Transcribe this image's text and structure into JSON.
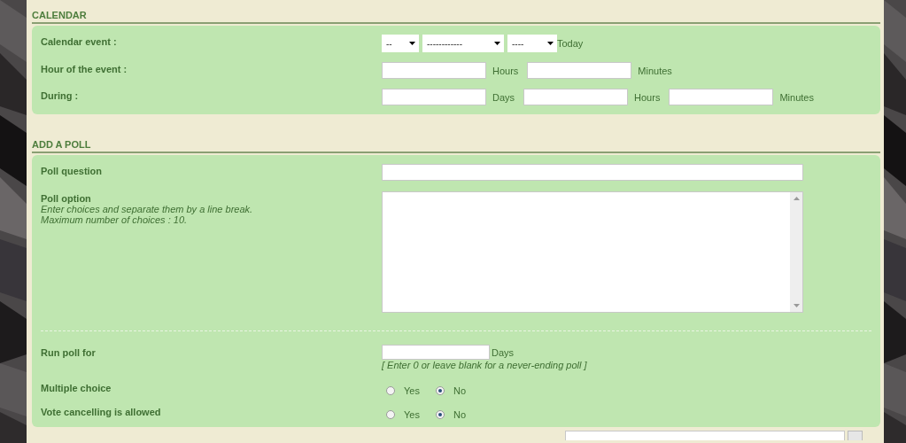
{
  "calendar": {
    "title": "CALENDAR",
    "rows": [
      {
        "kind": "date",
        "label": "Calendar event :",
        "selects": [
          "--",
          "------------",
          "----"
        ],
        "link": "Today"
      },
      {
        "kind": "fields",
        "label": "Hour of the event :",
        "units": [
          "Hours",
          "Minutes"
        ]
      },
      {
        "kind": "fields",
        "label": "During :",
        "units": [
          "Days",
          "Hours",
          "Minutes"
        ]
      }
    ]
  },
  "poll": {
    "title": "ADD A POLL",
    "question": {
      "label": "Poll question"
    },
    "option": {
      "label": "Poll option",
      "hints": [
        "Enter choices and separate them by a line break.",
        "Maximum number of choices : 10."
      ]
    },
    "duration": {
      "label": "Run poll for",
      "unit": "Days",
      "hint": "[ Enter 0 or leave blank for a never-ending poll ]"
    },
    "choices": [
      {
        "label": "Multiple choice",
        "options": [
          {
            "label": "Yes",
            "selected": false
          },
          {
            "label": "No",
            "selected": true
          }
        ]
      },
      {
        "label": "Vote cancelling is allowed",
        "options": [
          {
            "label": "Yes",
            "selected": false
          },
          {
            "label": "No",
            "selected": true
          }
        ]
      }
    ]
  }
}
